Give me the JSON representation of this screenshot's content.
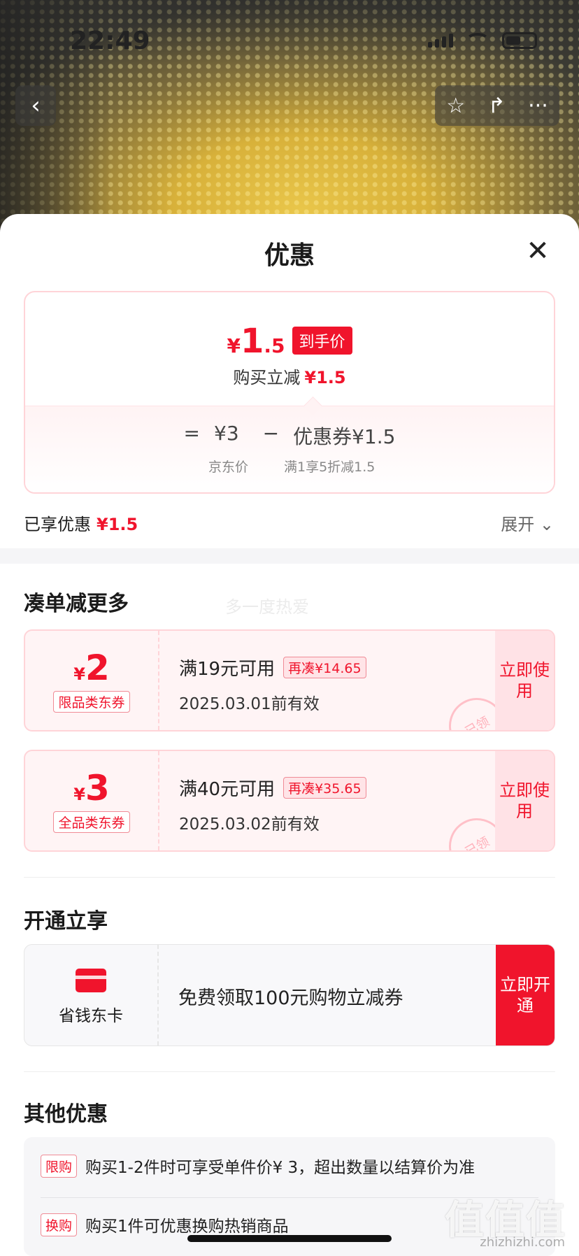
{
  "status": {
    "time": "22:49"
  },
  "nav": {
    "back_icon": "‹",
    "star_icon": "☆",
    "share_icon": "↱",
    "more_icon": "···"
  },
  "sheet": {
    "title": "优惠",
    "close_icon": "✕"
  },
  "price": {
    "currency": "¥",
    "int": "1",
    "dec": ".5",
    "final_tag": "到手价",
    "reduce_label": "购买立减",
    "reduce_value": "¥1.5",
    "eq": "=",
    "jd_price": "¥3",
    "minus": "−",
    "coupon_label": "优惠券¥1.5",
    "jd_price_label": "京东价",
    "coupon_desc": "满1享5折减1.5"
  },
  "enjoyed": {
    "label": "已享优惠",
    "value": "¥1.5",
    "expand": "展开 ⌄"
  },
  "watermark": "多一度热爱",
  "more": {
    "title": "凑单减更多",
    "coupons": [
      {
        "currency": "¥",
        "amount": "2",
        "category": "限品类东券",
        "condition": "满19元可用",
        "need": "再凑¥14.65",
        "date": "2025.03.01前有效",
        "button": "立即使用",
        "stamp": "已领"
      },
      {
        "currency": "¥",
        "amount": "3",
        "category": "全品类东券",
        "condition": "满40元可用",
        "need": "再凑¥35.65",
        "date": "2025.03.02前有效",
        "button": "立即使用",
        "stamp": "已领"
      }
    ]
  },
  "open": {
    "title": "开通立享",
    "card_name": "省钱东卡",
    "text": "免费领取100元购物立减券",
    "button": "立即开通"
  },
  "other": {
    "title": "其他优惠",
    "rows": [
      {
        "tag": "限购",
        "text": "购买1-2件时可享受单件价¥ 3，超出数量以结算价为准"
      },
      {
        "tag": "换购",
        "text": "购买1件可优惠换购热销商品"
      }
    ]
  },
  "site_logo": "值值值",
  "site_url": "zhizhizhi.com",
  "colors": {
    "accent": "#f0142c"
  }
}
